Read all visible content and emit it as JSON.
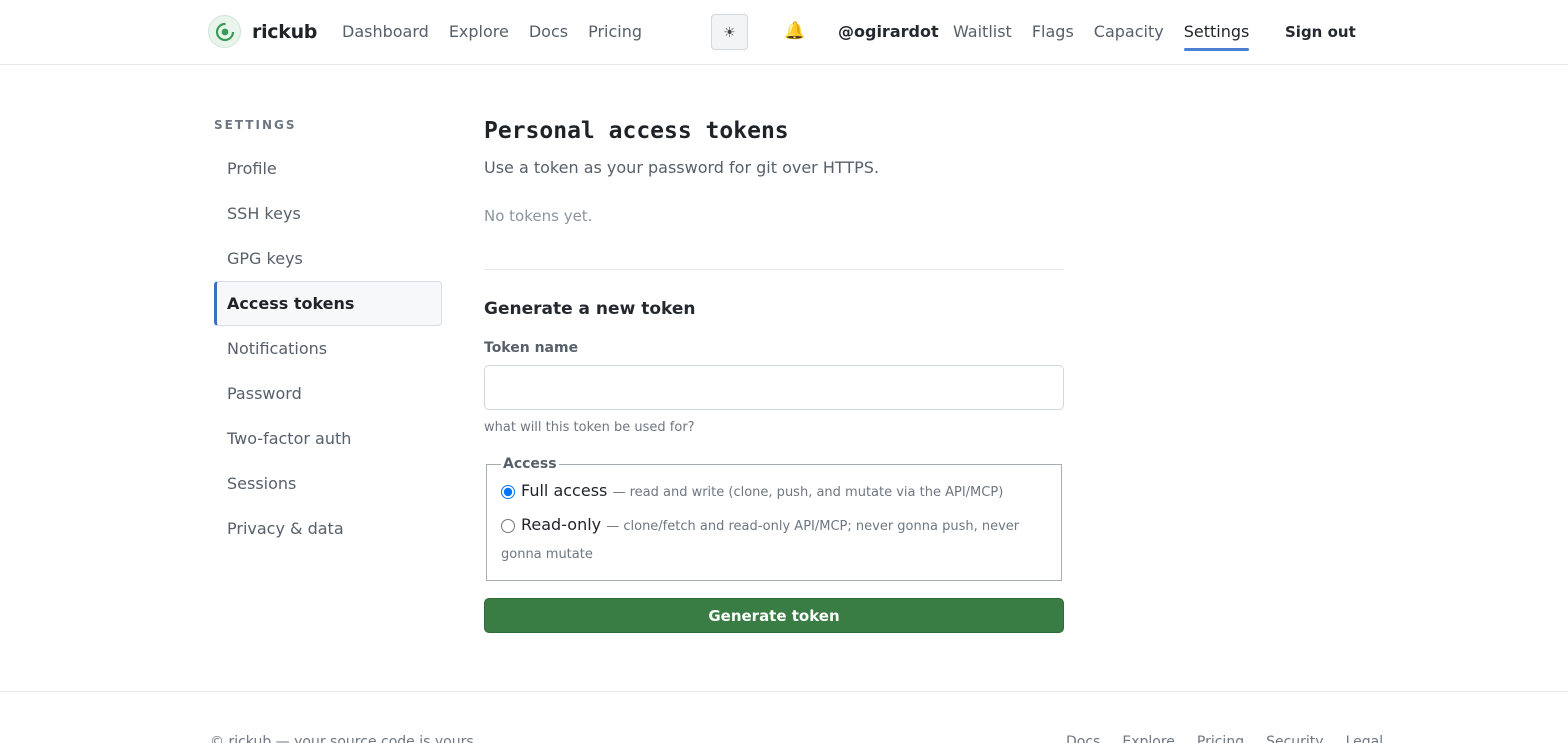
{
  "header": {
    "brand": "rickub",
    "nav_primary": [
      "Dashboard",
      "Explore",
      "Docs",
      "Pricing"
    ],
    "theme_glyph": "☀",
    "bell_glyph": "🔔",
    "username": "@ogirardot",
    "nav_secondary": [
      "Waitlist",
      "Flags",
      "Capacity",
      "Settings"
    ],
    "active_nav": "Settings",
    "signout": "Sign out"
  },
  "sidebar": {
    "title": "SETTINGS",
    "items": [
      "Profile",
      "SSH keys",
      "GPG keys",
      "Access tokens",
      "Notifications",
      "Password",
      "Two-factor auth",
      "Sessions",
      "Privacy & data"
    ],
    "active": "Access tokens"
  },
  "main": {
    "title": "Personal access tokens",
    "subtitle": "Use a token as your password for git over HTTPS.",
    "empty": "No tokens yet.",
    "generate_title": "Generate a new token",
    "token_label": "Token name",
    "token_value": "",
    "token_hint": "what will this token be used for?",
    "access_legend": "Access",
    "options": [
      {
        "label": "Full access",
        "desc": "— read and write (clone, push, and mutate via the API/MCP)",
        "checked": true
      },
      {
        "label": "Read-only",
        "desc": "— clone/fetch and read-only API/MCP; never gonna push, never gonna mutate",
        "checked": false
      }
    ],
    "button": "Generate token"
  },
  "footer": {
    "left": "© rickub — your source code is yours",
    "links": [
      "Docs",
      "Explore",
      "Pricing",
      "Security",
      "Legal"
    ]
  },
  "colors": {
    "accent": "#3b6fc2",
    "primary_button": "#3a7d44"
  }
}
